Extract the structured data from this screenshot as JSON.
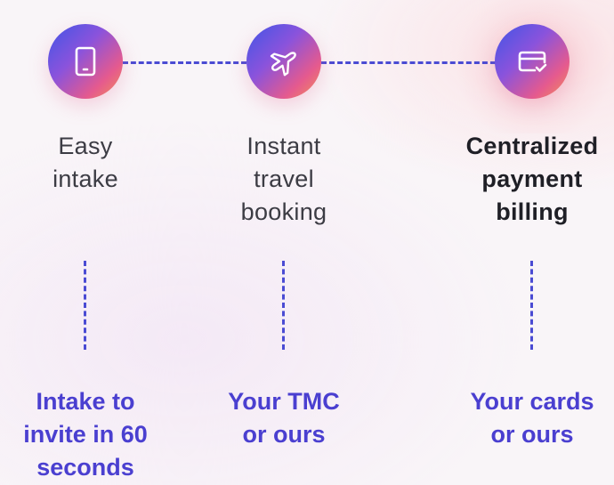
{
  "steps": [
    {
      "icon": "phone-icon",
      "title_lines": [
        "Easy",
        "intake"
      ],
      "detail_lines": [
        "Intake to",
        "invite in 60",
        "seconds"
      ],
      "highlighted": false
    },
    {
      "icon": "airplane-icon",
      "title_lines": [
        "Instant",
        "travel",
        "booking"
      ],
      "detail_lines": [
        "Your TMC",
        "or ours"
      ],
      "highlighted": false
    },
    {
      "icon": "credit-card-check-icon",
      "title_lines": [
        "Centralized",
        "payment",
        "billing"
      ],
      "detail_lines": [
        "Your cards",
        "or ours"
      ],
      "highlighted": true
    }
  ],
  "colors": {
    "accent": "#4a3fd0",
    "connector": "#4a4bd3",
    "gradient": [
      "#3f55e6",
      "#8a53dc",
      "#e55a8e",
      "#f39255"
    ]
  }
}
